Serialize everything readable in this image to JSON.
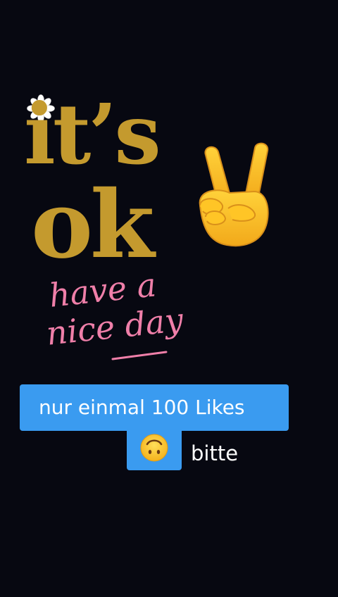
{
  "sticker": {
    "line1": "it’s",
    "line2": "ok",
    "color": "#c49a2e",
    "flower_icon": "daisy-icon",
    "hand_icon": "victory-hand-icon"
  },
  "handwriting": {
    "line1": "have a",
    "line2": "nice day",
    "color": "#ef7fa9"
  },
  "captions": {
    "line1": "nur einmal 100 Likes",
    "line2": "bitte",
    "emoji_icon": "upside-down-face-icon",
    "background": "#3a9bf0",
    "text_color": "#ffffff"
  },
  "background_color": "#070811"
}
